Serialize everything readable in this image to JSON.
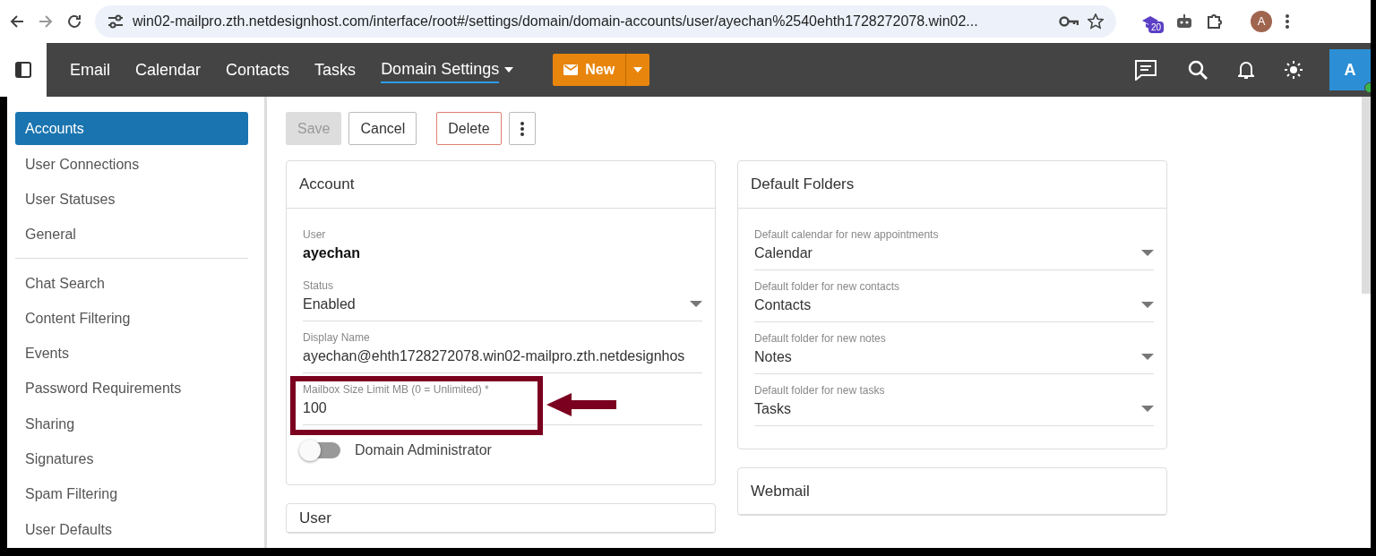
{
  "browser": {
    "url": "win02-mailpro.zth.netdesignhost.com/interface/root#/settings/domain/domain-accounts/user/ayechan%2540ehth1728272078.win02...",
    "extension_badge": "20",
    "profile_initial": "A"
  },
  "nav": {
    "items": [
      {
        "label": "Email",
        "selected": false,
        "dropdown": false
      },
      {
        "label": "Calendar",
        "selected": false,
        "dropdown": false
      },
      {
        "label": "Contacts",
        "selected": false,
        "dropdown": false
      },
      {
        "label": "Tasks",
        "selected": false,
        "dropdown": false
      },
      {
        "label": "Domain Settings",
        "selected": true,
        "dropdown": true
      }
    ],
    "new_button": "New",
    "avatar": "A",
    "online": true
  },
  "sidebar": {
    "groups": [
      {
        "items": [
          {
            "label": "Accounts",
            "selected": true
          },
          {
            "label": "User Connections",
            "selected": false
          },
          {
            "label": "User Statuses",
            "selected": false
          },
          {
            "label": "General",
            "selected": false
          }
        ]
      },
      {
        "items": [
          {
            "label": "Chat Search",
            "selected": false
          },
          {
            "label": "Content Filtering",
            "selected": false
          },
          {
            "label": "Events",
            "selected": false
          },
          {
            "label": "Password Requirements",
            "selected": false
          },
          {
            "label": "Sharing",
            "selected": false
          },
          {
            "label": "Signatures",
            "selected": false
          },
          {
            "label": "Spam Filtering",
            "selected": false
          },
          {
            "label": "User Defaults",
            "selected": false
          }
        ]
      }
    ]
  },
  "toolbar": {
    "buttons": [
      {
        "kind": "save",
        "label": "Save",
        "disabled": true
      },
      {
        "kind": "plain",
        "label": "Cancel",
        "disabled": false
      },
      {
        "kind": "danger",
        "label": "Delete",
        "disabled": false
      },
      {
        "kind": "more",
        "disabled": false
      }
    ]
  },
  "account": {
    "title": "Account",
    "fields": [
      {
        "kind": "static",
        "label": "User",
        "value": "ayechan",
        "highlighted": false
      },
      {
        "kind": "select",
        "label": "Status",
        "value": "Enabled",
        "highlighted": false
      },
      {
        "kind": "text",
        "label": "Display Name",
        "value": "ayechan@ehth1728272078.win02-mailpro.zth.netdesignhos",
        "highlighted": false
      },
      {
        "kind": "text",
        "label": "Mailbox Size Limit MB (0 = Unlimited) *",
        "value": "100",
        "highlighted": true
      }
    ],
    "toggle": {
      "label": "Domain Administrator",
      "on": false
    }
  },
  "user_card": {
    "title": "User"
  },
  "default_folders": {
    "title": "Default Folders",
    "fields": [
      {
        "kind": "select",
        "label": "Default calendar for new appointments",
        "value": "Calendar"
      },
      {
        "kind": "select",
        "label": "Default folder for new contacts",
        "value": "Contacts"
      },
      {
        "kind": "select",
        "label": "Default folder for new notes",
        "value": "Notes"
      },
      {
        "kind": "select",
        "label": "Default folder for new tasks",
        "value": "Tasks"
      }
    ]
  },
  "webmail": {
    "title": "Webmail"
  }
}
